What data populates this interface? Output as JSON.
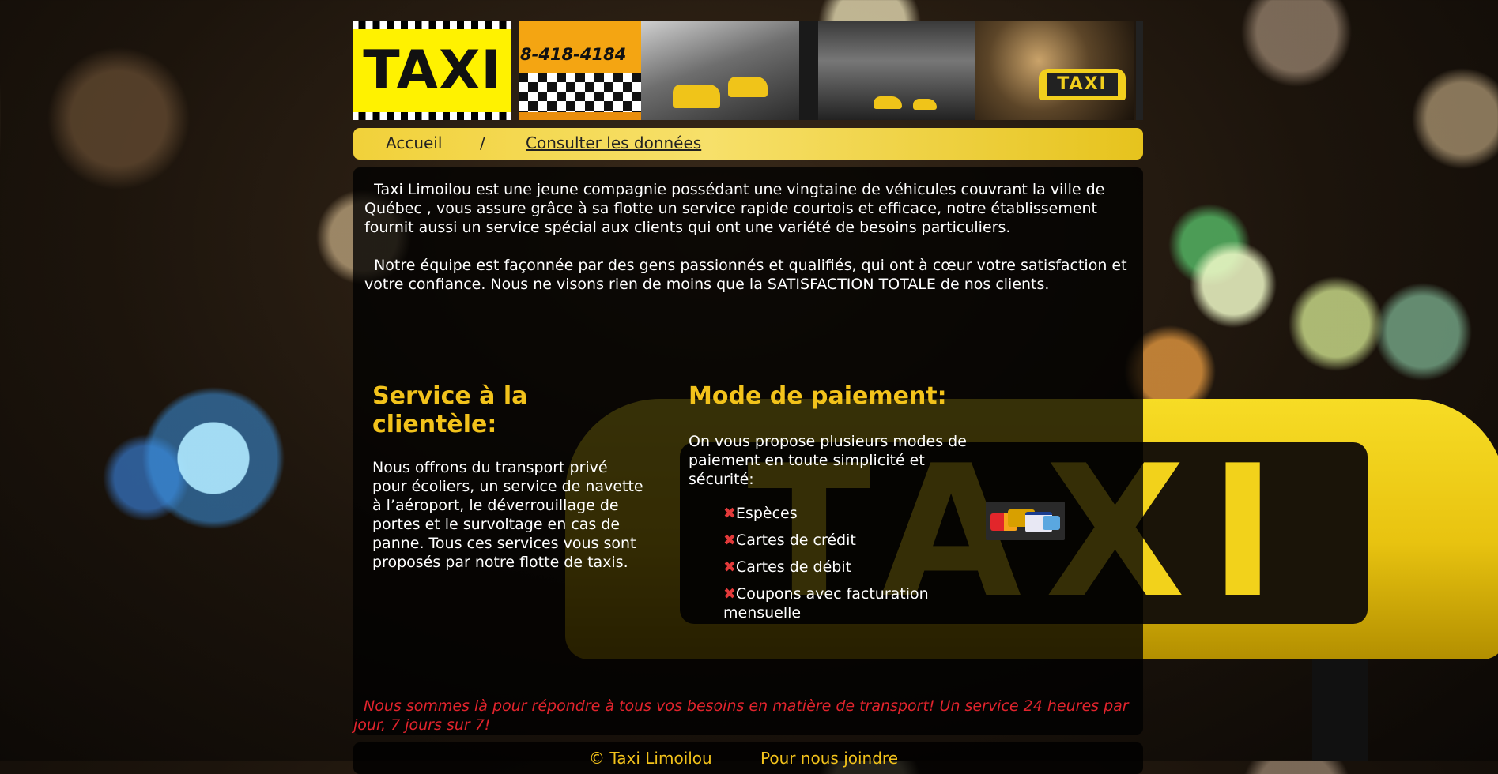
{
  "banner": {
    "logo_text": "TAXI",
    "phone": "8-418-4184",
    "roof_sign_text": "TAXI"
  },
  "nav": {
    "home": "Accueil",
    "separator": "/",
    "data_link": "Consulter les données"
  },
  "intro": {
    "paragraph1": "Taxi Limoilou est une jeune compagnie possédant une vingtaine de véhicules couvrant la ville de Québec , vous assure grâce à sa flotte un service rapide courtois et efficace, notre établissement fournit aussi un service spécial aux clients qui ont une variété de besoins particuliers.",
    "paragraph2": "Notre équipe est façonnée par des gens passionnés et qualifiés, qui ont à cœur votre satisfaction et votre confiance. Nous ne visons rien de moins que la SATISFACTION TOTALE de nos clients."
  },
  "service": {
    "title": "Service à la clientèle:",
    "text": "Nous offrons du transport privé pour écoliers, un service de navette à l’aéroport, le déverrouillage de portes et le survoltage en cas de panne. Tous ces services vous sont proposés par notre flotte de taxis."
  },
  "payment": {
    "title": "Mode de paiement:",
    "text": "On vous propose plusieurs modes de paiement en toute simplicité et sécurité:",
    "bullet": "✖",
    "items": [
      "Espèces",
      "Cartes de crédit",
      "Cartes de débit",
      "Coupons avec facturation mensuelle"
    ]
  },
  "motto": "Nous sommes là pour répondre à tous vos besoins en matière de transport! Un service 24 heures par jour, 7 jours sur 7!",
  "footer": {
    "copyright": "© Taxi Limoilou",
    "contact": "Pour nous joindre"
  },
  "background": {
    "sign_text": "TAXI"
  },
  "colors": {
    "accent_yellow": "#f2c21b",
    "motto_red": "#e1242d",
    "nav_yellow": "#f1d13a"
  }
}
